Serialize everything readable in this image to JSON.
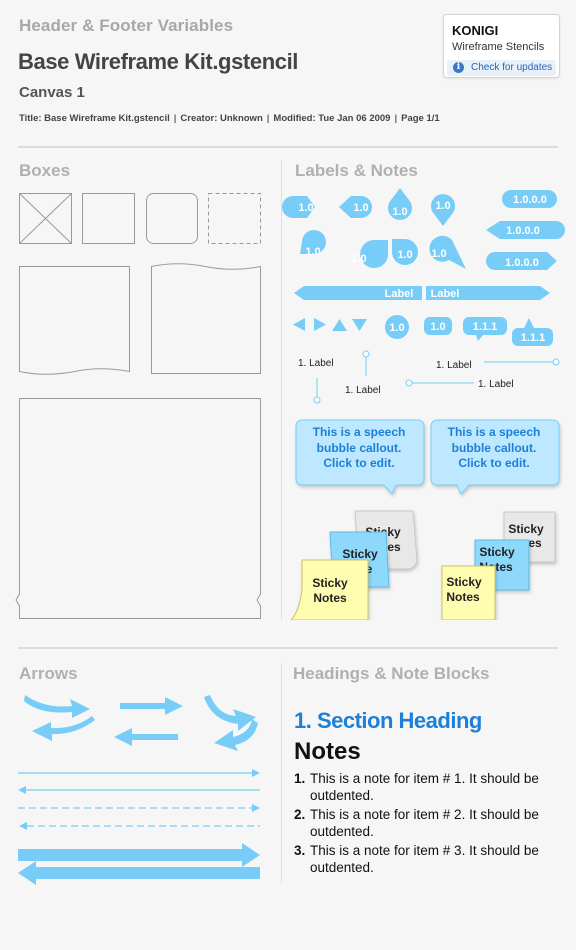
{
  "header": {
    "variables_title": "Header & Footer Variables",
    "doc_title": "Base Wireframe Kit.gstencil",
    "canvas_name": "Canvas 1",
    "meta": [
      "Title: Base Wireframe Kit.gstencil",
      "Creator: Unknown",
      "Modified: Tue Jan 06 2009",
      "Page 1/1"
    ]
  },
  "konigi": {
    "name": "KONIGI",
    "subtitle": "Wireframe Stencils",
    "info_glyph": "i",
    "link": "Check for updates"
  },
  "sections": {
    "boxes": "Boxes",
    "labels_notes": "Labels & Notes",
    "arrows": "Arrows",
    "headings": "Headings & Note Blocks"
  },
  "labels": {
    "marker": "1.0",
    "marker_long": "1.0.0.0",
    "bar_label": "Label",
    "callout_small": "1.1.1",
    "pin_label": "1. Label"
  },
  "callouts": {
    "line1": "This is a speech",
    "line2": "bubble callout.",
    "line3": "Click to edit."
  },
  "sticky": {
    "word1": "Sticky",
    "word2": "Notes",
    "partial2": "te",
    "partial3": "es"
  },
  "headings": {
    "section_heading": "1. Section Heading",
    "notes_title": "Notes",
    "notes": [
      {
        "num": "1.",
        "text": "This is a note for item # 1. It should be outdented."
      },
      {
        "num": "2.",
        "text": "This is a note for item # 2. It should be outdented."
      },
      {
        "num": "3.",
        "text": "This is a note for item # 3. It should be outdented."
      }
    ]
  },
  "colors": {
    "accent_light": "#77cdf7",
    "heading_blue": "#1e7fd6",
    "callout_fill": "#bde8ff",
    "sticky_yellow": "#fffdb0",
    "sticky_blue": "#8ed8fb",
    "sticky_gray": "#e8e8e8"
  }
}
